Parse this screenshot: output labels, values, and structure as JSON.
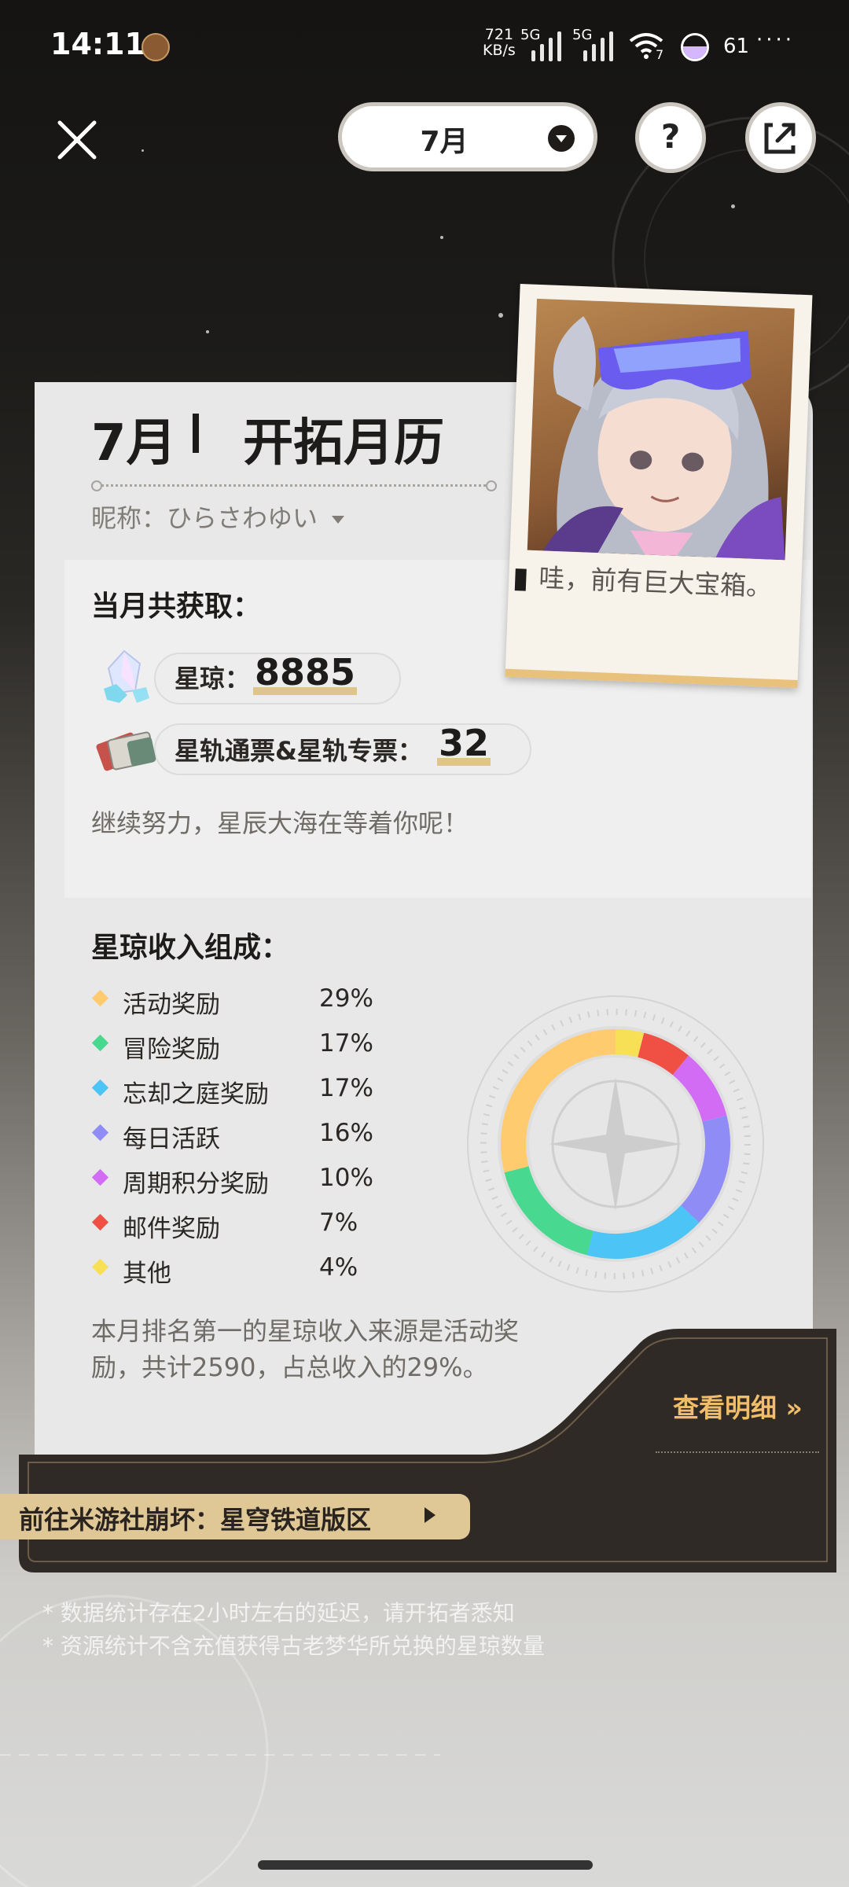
{
  "status_bar": {
    "time": "14:11",
    "net_speed_value": "721",
    "net_speed_unit": "KB/s",
    "sim1": "5G",
    "sim2": "5G",
    "wifi_badge": "7",
    "battery": "61"
  },
  "toolbar": {
    "month": "7月",
    "help": "?"
  },
  "card": {
    "title_month": "7月",
    "title_text": "开拓月历",
    "nickname_label": "昵称：",
    "nickname": "ひらさわゆい",
    "gain_title": "当月共获取：",
    "jade_label": "星琼：",
    "jade_value": "8885",
    "pass_label": "星轨通票&星轨专票：",
    "pass_value": "32",
    "encourage": "继续努力，星辰大海在等着你呢！",
    "composition_title": "星琼收入组成：",
    "summary": "本月排名第一的星琼收入来源是活动奖励，共计2590，占总收入的29%。",
    "detail_link": "查看明细 »",
    "community_button": "前往米游社崩坏：星穹铁道版区"
  },
  "polaroid": {
    "caption": "哇，前有巨大宝箱。"
  },
  "chart_data": {
    "type": "pie",
    "categories": [
      "活动奖励",
      "冒险奖励",
      "忘却之庭奖励",
      "每日活跃",
      "周期积分奖励",
      "邮件奖励",
      "其他"
    ],
    "values": [
      29,
      17,
      17,
      16,
      10,
      7,
      4
    ],
    "labels": [
      "29%",
      "17%",
      "17%",
      "16%",
      "10%",
      "7%",
      "4%"
    ],
    "colors": [
      "#ffcb6e",
      "#49d88f",
      "#4cc4f5",
      "#8f8cf6",
      "#d36cf5",
      "#ef5043",
      "#f7df56"
    ]
  },
  "notes": [
    "* 数据统计存在2小时左右的延迟，请开拓者悉知",
    "* 资源统计不含充值获得古老梦华所兑换的星琼数量"
  ]
}
